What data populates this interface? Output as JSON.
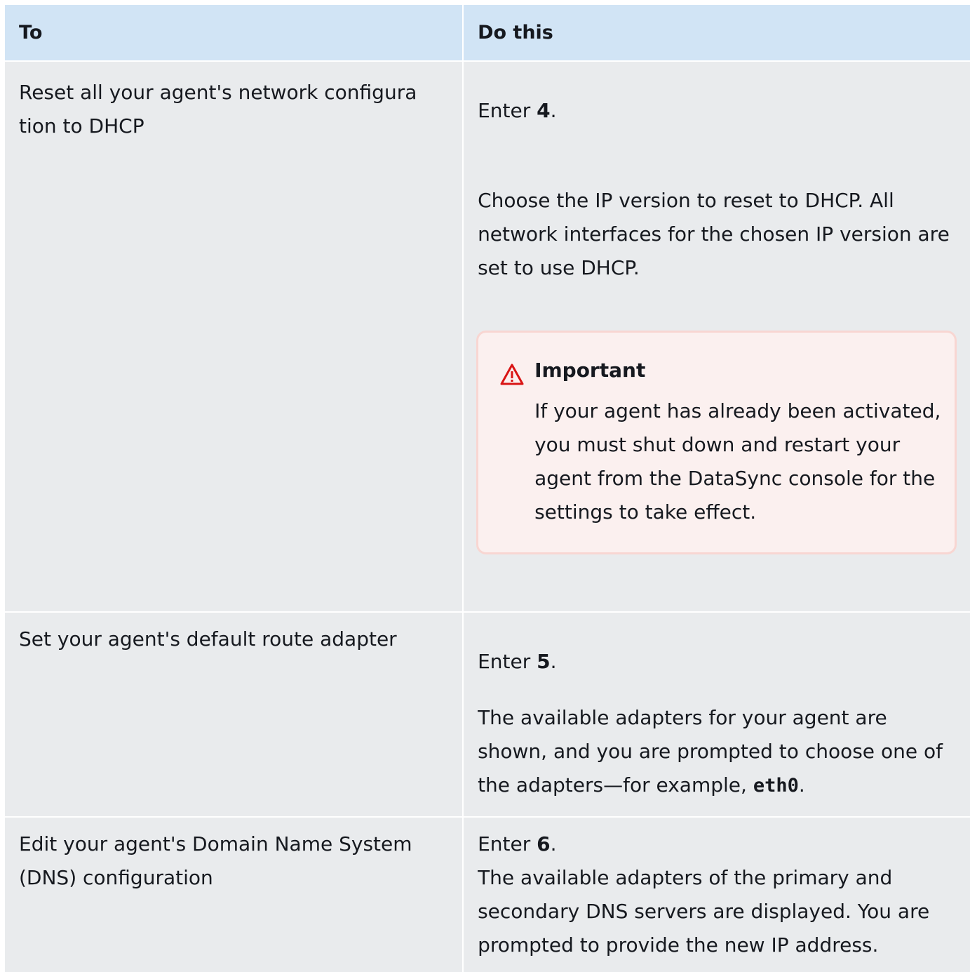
{
  "table": {
    "headers": [
      "To",
      "Do this"
    ],
    "rows": [
      {
        "to": "Reset all your agent's network configura tion to DHCP",
        "enter_prefix": "Enter ",
        "enter_value": "4",
        "enter_suffix": ".",
        "description": "Choose the IP version to reset to DHCP. All network interfaces for the chosen IP version are set to use DHCP.",
        "callout": {
          "title": "Important",
          "body": "If your agent has already been activated, you must shut down and restart your agent  from the DataSync console for the settings to take effect."
        }
      },
      {
        "to": "Set your agent's default route adapter",
        "enter_prefix": "Enter ",
        "enter_value": "5",
        "enter_suffix": ".",
        "description": "The available adapters for your agent are shown, and you are prompted to choose one  of the adapters—for example, ",
        "code": "eth0",
        "description_suffix": "."
      },
      {
        "to": "Edit your agent's Domain Name System (DNS) configuration",
        "enter_prefix": "Enter ",
        "enter_value": "6",
        "enter_suffix": ".",
        "description": "The available adapters of the primary and  secondary DNS servers are displayed. You are prompted to provide  the new IP address."
      }
    ]
  },
  "colors": {
    "header_bg": "#d1e4f5",
    "cell_bg": "#e9ebed",
    "callout_bg": "#fbf0ef",
    "callout_border": "#f8d6d2",
    "warning_icon": "#d91515"
  },
  "icons": {
    "callout_icon": "warning-triangle-icon"
  }
}
